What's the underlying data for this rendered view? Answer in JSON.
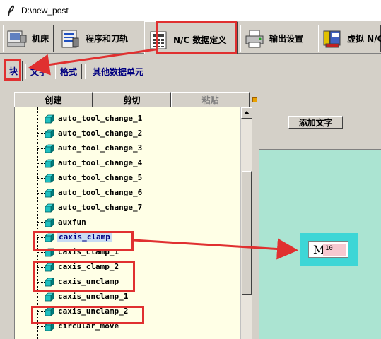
{
  "window": {
    "title": "D:\\new_post"
  },
  "main_tabs": [
    {
      "label": "机床",
      "icon": "machine-tool-icon"
    },
    {
      "label": "程序和刀轨",
      "icon": "program-toolpath-icon"
    },
    {
      "label": "N/C 数据定义",
      "icon": "nc-data-grid-icon"
    },
    {
      "label": "输出设置",
      "icon": "printer-icon"
    },
    {
      "label": "虚拟 N/C",
      "icon": "virtual-nc-icon"
    }
  ],
  "sub_tabs": [
    {
      "label": "块"
    },
    {
      "label": "文字"
    },
    {
      "label": "格式"
    },
    {
      "label": "其他数据单元"
    }
  ],
  "toolbar": {
    "create": "创建",
    "cut": "剪切",
    "paste": "粘贴"
  },
  "tree_items": [
    {
      "label": "auto_tool_change_1"
    },
    {
      "label": "auto_tool_change_2"
    },
    {
      "label": "auto_tool_change_3"
    },
    {
      "label": "auto_tool_change_4"
    },
    {
      "label": "auto_tool_change_5"
    },
    {
      "label": "auto_tool_change_6"
    },
    {
      "label": "auto_tool_change_7"
    },
    {
      "label": "auxfun"
    },
    {
      "label": "caxis_clamp",
      "selected": true
    },
    {
      "label": "caxis_clamp_1"
    },
    {
      "label": "caxis_clamp_2"
    },
    {
      "label": "caxis_unclamp"
    },
    {
      "label": "caxis_unclamp_1"
    },
    {
      "label": "caxis_unclamp_2"
    },
    {
      "label": "circular_move"
    }
  ],
  "add_text_button": "添加文字",
  "block_preview": {
    "address": "M",
    "value": "10"
  },
  "colors": {
    "annotation_red": "#e03030",
    "preview_bg": "#abe4d2",
    "highlight_cyan": "#3dd6d6",
    "value_pink": "#f7c8d0",
    "tree_bg": "#ffffe6"
  }
}
